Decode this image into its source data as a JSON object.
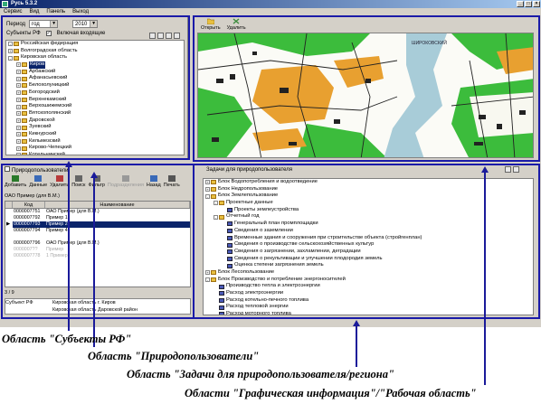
{
  "window": {
    "title": "Русь 5.3.2"
  },
  "menu": [
    "Сервис",
    "Вид",
    "Панель",
    "Выход"
  ],
  "period": {
    "label": "Период",
    "period_value": "год",
    "year_value": "2010"
  },
  "subjects": {
    "title": "Субъекты РФ",
    "include_label": "Включая входящие",
    "tree": [
      {
        "label": "Российская федерация",
        "level": 0,
        "exp": "-"
      },
      {
        "label": "Волгоградская область",
        "level": 0,
        "exp": "+"
      },
      {
        "label": "Кировская область",
        "level": 0,
        "exp": "-"
      },
      {
        "label": "Киров",
        "level": 1,
        "exp": "+",
        "selected": true
      },
      {
        "label": "Арбажский",
        "level": 1,
        "exp": "+"
      },
      {
        "label": "Афанасьевский",
        "level": 1,
        "exp": "+"
      },
      {
        "label": "Белохолуницкий",
        "level": 1,
        "exp": "+"
      },
      {
        "label": "Богородский",
        "level": 1,
        "exp": "+"
      },
      {
        "label": "Верхнекамский",
        "level": 1,
        "exp": "+"
      },
      {
        "label": "Верхошижемский",
        "level": 1,
        "exp": "+"
      },
      {
        "label": "Вятскополянский",
        "level": 1,
        "exp": "+"
      },
      {
        "label": "Даровской",
        "level": 1,
        "exp": "+"
      },
      {
        "label": "Зуевский",
        "level": 1,
        "exp": "+"
      },
      {
        "label": "Кикнурский",
        "level": 1,
        "exp": "+"
      },
      {
        "label": "Кильмезский",
        "level": 1,
        "exp": "+"
      },
      {
        "label": "Кирово-Чепецкий",
        "level": 1,
        "exp": "+"
      },
      {
        "label": "Котельничский",
        "level": 1,
        "exp": "+"
      }
    ]
  },
  "users": {
    "title": "Природопользователи",
    "toolbar": [
      "Добавить",
      "Данные",
      "Удалить",
      "Поиск",
      "Фильтр",
      "Подразделения",
      "Назад",
      "Печать"
    ],
    "org": "ОАО Пример (для В.М.)",
    "columns": [
      "Код",
      "Наименование"
    ],
    "rows": [
      {
        "code": "0000007751",
        "name": "ОАО Пример (для В.М.)",
        "state": "normal"
      },
      {
        "code": "0000007792",
        "name": "Пример 1",
        "state": "normal"
      },
      {
        "code": "0000007793",
        "name": "Пример 2",
        "state": "selected"
      },
      {
        "code": "0000007794",
        "name": "Пример 4",
        "state": "normal"
      },
      {
        "code": "",
        "name": "",
        "state": "normal"
      },
      {
        "code": "0000007796",
        "name": "ОАО Пример (для В.М.)",
        "state": "normal"
      },
      {
        "code": "0000007??",
        "name": "Пример",
        "state": "grey"
      },
      {
        "code": "0000007778",
        "name": "1 Пример",
        "state": "grey"
      },
      {
        "code": "",
        "name": "",
        "state": "grey"
      }
    ],
    "counter": "3 / 9",
    "status_rows": [
      {
        "k": "Субъект РФ",
        "v": "Кировская область г. Киров"
      },
      {
        "k": "",
        "v": "Кировская область Даровской район"
      }
    ]
  },
  "map": {
    "toolbar": [
      "Открыть",
      "Удалить"
    ],
    "place_label": "ШИРОКОВСКИЙ"
  },
  "tasks": {
    "title": "Задачи для природопользователя",
    "tree": [
      {
        "label": "Блок Водопотребления и водоотведение",
        "level": 0,
        "exp": "+"
      },
      {
        "label": "Блок Недропользование",
        "level": 0,
        "exp": "+"
      },
      {
        "label": "Блок Землепользование",
        "level": 0,
        "exp": "-"
      },
      {
        "label": "Проектные данные",
        "level": 1,
        "exp": "-"
      },
      {
        "label": "Проекты землеустройства",
        "level": 2,
        "exp": ""
      },
      {
        "label": "Отчетный год",
        "level": 1,
        "exp": "-"
      },
      {
        "label": "Генеральный план промплощадки",
        "level": 2,
        "exp": ""
      },
      {
        "label": "Сведения о заземлении",
        "level": 2,
        "exp": ""
      },
      {
        "label": "Временные здания и сооружения при строительстве объекта (стройгенплан)",
        "level": 2,
        "exp": ""
      },
      {
        "label": "Сведения о производстве сельскохозяйственных культур",
        "level": 2,
        "exp": ""
      },
      {
        "label": "Сведения о загрязнении, захламлении, деградации",
        "level": 2,
        "exp": ""
      },
      {
        "label": "Сведения о рекультивации и улучшении плодородия земель",
        "level": 2,
        "exp": ""
      },
      {
        "label": "Оценка степени загрязнения земель",
        "level": 2,
        "exp": ""
      },
      {
        "label": "Блок Лесопользование",
        "level": 0,
        "exp": "+"
      },
      {
        "label": "Блок Производство и потребление энергоносителей",
        "level": 0,
        "exp": "-"
      },
      {
        "label": "Производство тепла и электроэнергии",
        "level": 1,
        "exp": ""
      },
      {
        "label": "Расход электроэнергии",
        "level": 1,
        "exp": ""
      },
      {
        "label": "Расход котельно-печного топлива",
        "level": 1,
        "exp": ""
      },
      {
        "label": "Расход тепловой энергии",
        "level": 1,
        "exp": ""
      },
      {
        "label": "Расход моторного топлива",
        "level": 1,
        "exp": ""
      }
    ]
  },
  "labels": {
    "subjects": "Область \"Субъекты РФ\"",
    "users": "Область \"Природопользователи\"",
    "tasks": "Область \"Задачи для природопользователя/региона\"",
    "graphics": "Области \"Графическая информация\"/\"Рабочая область\""
  },
  "colors": {
    "highlight": "#1a1aa8",
    "selection": "#0a246a",
    "window": "#d4d0c8"
  }
}
